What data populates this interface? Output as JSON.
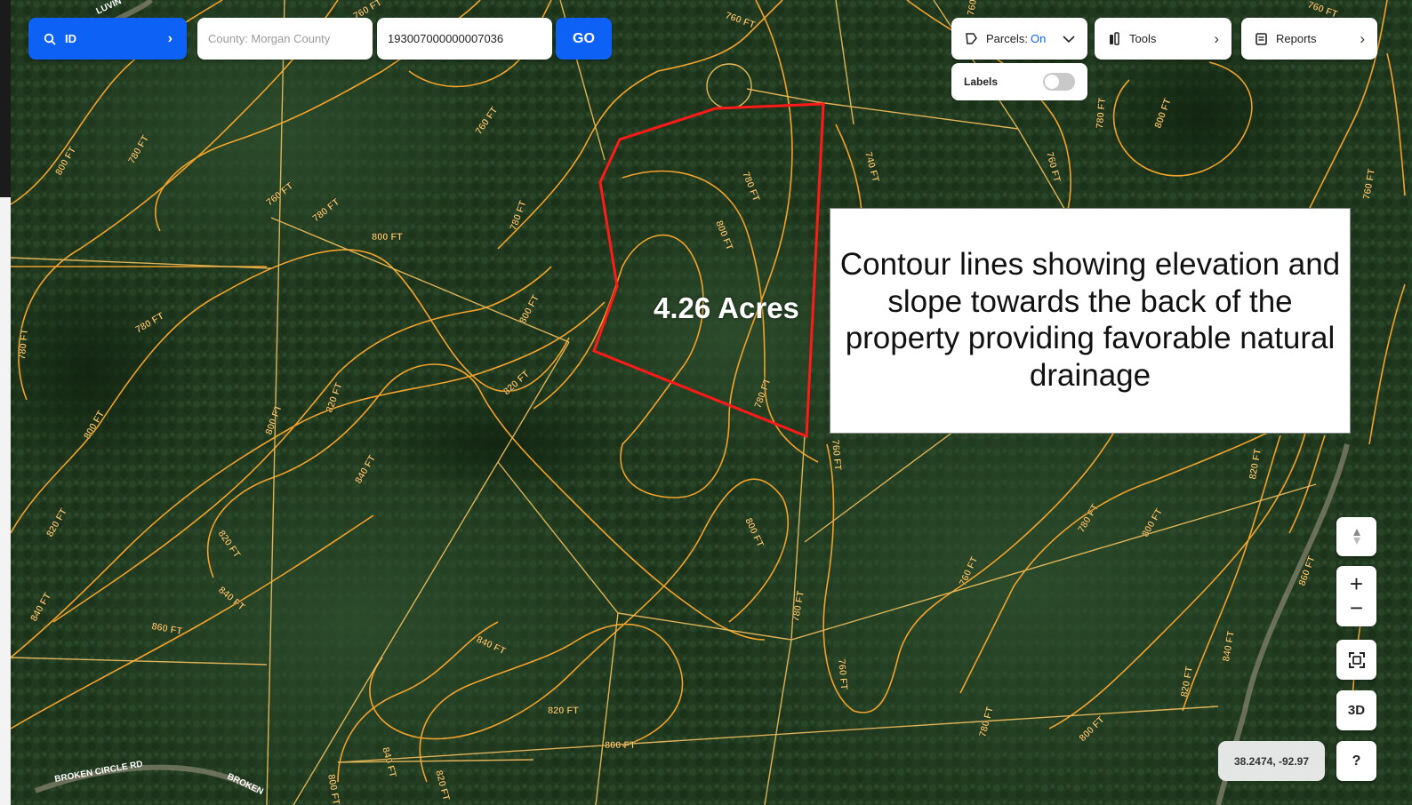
{
  "search": {
    "type_label": "ID",
    "county_placeholder": "County: Morgan County",
    "parcel_id_value": "193007000000007036",
    "go_label": "GO"
  },
  "layers": {
    "parcels_label": "Parcels:",
    "parcels_state": "On",
    "tools_label": "Tools",
    "reports_label": "Reports",
    "labels_label": "Labels",
    "labels_enabled": false
  },
  "parcel": {
    "acreage_label": "4.26 Acres",
    "outline_color": "#ff1a1a"
  },
  "annotation": {
    "text": "Contour lines showing elevation and slope towards the back of the property providing favorable natural drainage"
  },
  "map": {
    "coordinates": "38.2474, -92.97",
    "view_3d_label": "3D",
    "help_label": "?",
    "contour_color": "#f2a22c",
    "contour_labels": [
      "760 FT",
      "780 FT",
      "800 FT",
      "820 FT",
      "840 FT",
      "860 FT",
      "740 FT"
    ],
    "road_labels": [
      "BROKEN CIRCLE RD",
      "BROKEN",
      "LUVIN"
    ]
  },
  "icons": {
    "search": "search-icon",
    "parcels": "parcel-shape-icon",
    "tools": "tools-icon",
    "reports": "reports-icon",
    "compass": "compass-icon",
    "zoom_in": "plus-icon",
    "zoom_out": "minus-icon",
    "fit": "fit-bounds-icon"
  }
}
